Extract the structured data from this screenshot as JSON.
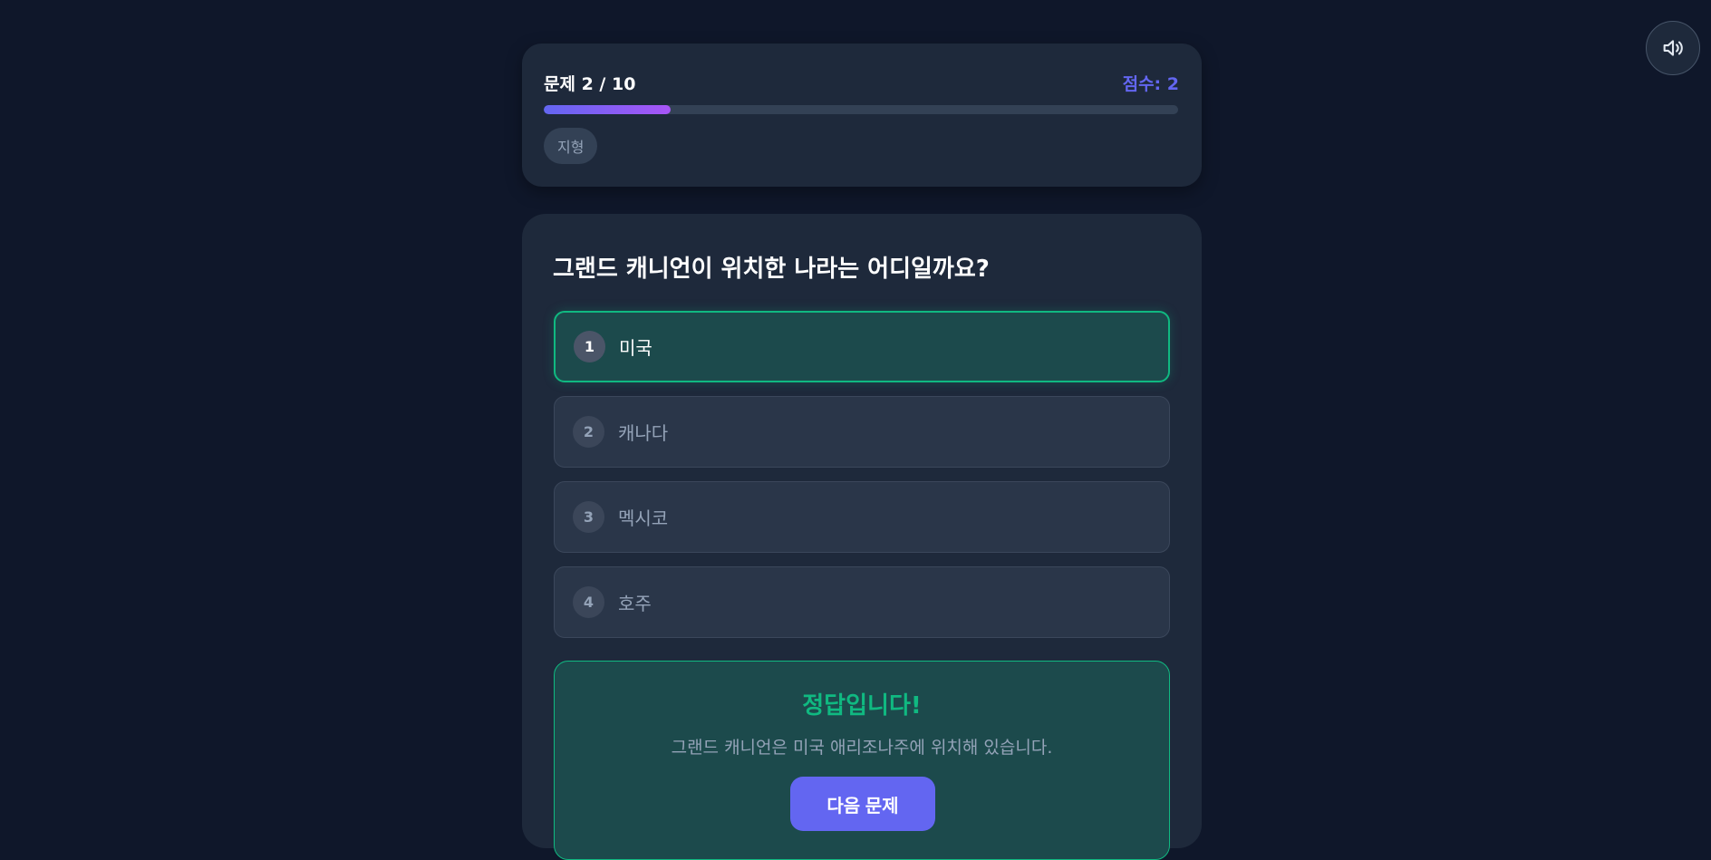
{
  "header": {
    "question_label": "문제",
    "question_progress": "2 / 10",
    "score": "점수: 2",
    "progress_fraction": 0.2,
    "category": "지형"
  },
  "sound_button": {
    "icon": "speaker-volume-icon"
  },
  "quiz": {
    "question": "그랜드 캐니언이 위치한 나라는 어디일까요?",
    "options": [
      {
        "number": "1",
        "label": "미국",
        "state": "correct"
      },
      {
        "number": "2",
        "label": "캐나다",
        "state": "disabled"
      },
      {
        "number": "3",
        "label": "멕시코",
        "state": "disabled"
      },
      {
        "number": "4",
        "label": "호주",
        "state": "disabled"
      }
    ]
  },
  "feedback": {
    "title": "정답입니다!",
    "explanation": "그랜드 캐니언은 미국 애리조나주에 위치해 있습니다.",
    "next_label": "다음 문제"
  },
  "colors": {
    "background": "#0f172a",
    "card": "#1e293b",
    "accent": "#6366f1",
    "accent_gradient_end": "#a855f7",
    "correct": "#10b981"
  }
}
